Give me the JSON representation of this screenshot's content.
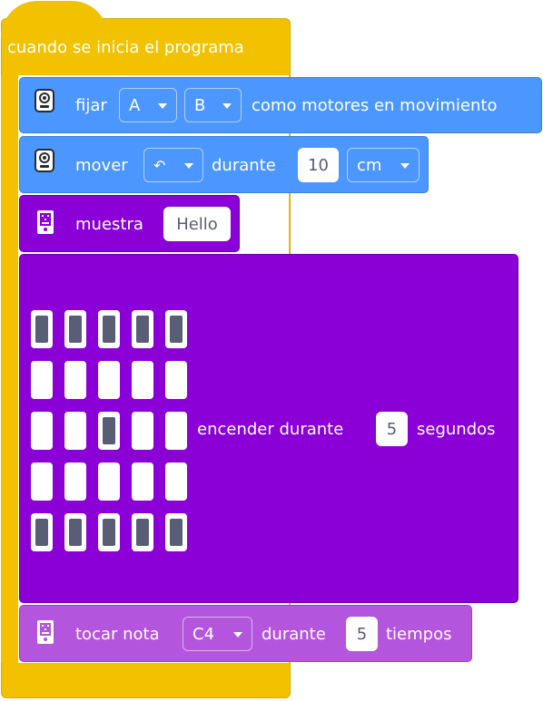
{
  "colors": {
    "events": "#f2c200",
    "motion": "#4c97ff",
    "display": "#8a00d6",
    "sound": "#b455dd"
  },
  "hat": {
    "label": "cuando se inicia el programa"
  },
  "set_motors": {
    "icon": "robot-face-icon",
    "label": "fijar",
    "motor_left": "A",
    "motor_right": "B",
    "suffix": "como motores en movimiento"
  },
  "move": {
    "icon": "robot-face-icon",
    "label": "mover",
    "direction_symbol": "↶",
    "middle": "durante",
    "amount": "10",
    "unit": "cm"
  },
  "show": {
    "icon": "led-matrix-icon",
    "label": "muestra",
    "text": "Hello"
  },
  "light_up": {
    "grid": [
      [
        1,
        1,
        1,
        1,
        1
      ],
      [
        0,
        0,
        0,
        0,
        0
      ],
      [
        0,
        0,
        1,
        0,
        0
      ],
      [
        0,
        0,
        0,
        0,
        0
      ],
      [
        1,
        1,
        1,
        1,
        1
      ]
    ],
    "label": "encender durante",
    "seconds": "5",
    "suffix": "segundos"
  },
  "play_note": {
    "icon": "led-matrix-icon",
    "label": "tocar nota",
    "note": "C4",
    "middle": "durante",
    "beats": "5",
    "suffix": "tiempos"
  }
}
